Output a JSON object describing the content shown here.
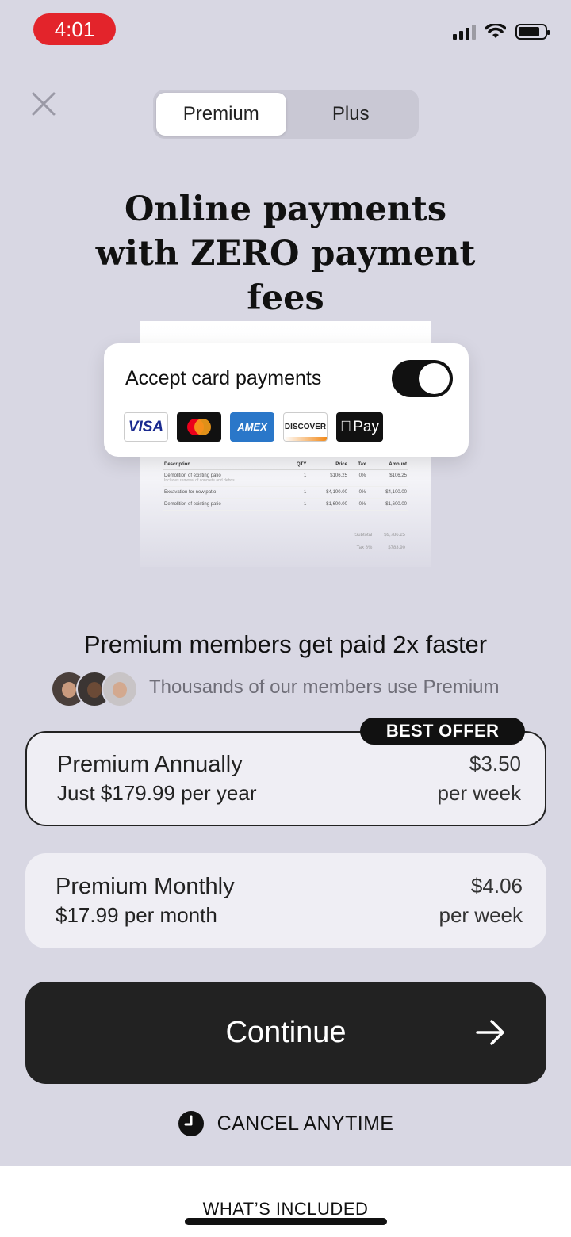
{
  "status_bar": {
    "time": "4:01"
  },
  "tabs": [
    {
      "label": "Premium",
      "active": true
    },
    {
      "label": "Plus",
      "active": false
    }
  ],
  "headline": "Online payments with ZERO payment fees",
  "card_payments": {
    "label": "Accept card payments",
    "toggle_on": true,
    "logos": [
      "VISA",
      "mastercard",
      "AMEX",
      "DISCOVER",
      "Pay"
    ]
  },
  "invoice": {
    "columns": [
      "Description",
      "QTY",
      "Price",
      "Tax",
      "Amount"
    ],
    "rows": [
      {
        "desc": "Demolition of existing patio",
        "sub": "Includes removal of concrete and debris",
        "qty": "1",
        "price": "$106.25",
        "tax": "0%",
        "amount": "$106.25"
      },
      {
        "desc": "Excavation for new patio",
        "sub": "",
        "qty": "1",
        "price": "$4,100.00",
        "tax": "0%",
        "amount": "$4,100.00"
      },
      {
        "desc": "Demolition of existing patio",
        "sub": "",
        "qty": "1",
        "price": "$1,600.00",
        "tax": "0%",
        "amount": "$1,600.00"
      }
    ],
    "subtotal_label": "Subtotal",
    "subtotal": "$9,786.25",
    "tax_label": "Tax 8%",
    "tax": "$783.90"
  },
  "social": {
    "title": "Premium members get paid 2x faster",
    "subtitle": "Thousands of our members use Premium"
  },
  "plans": {
    "badge": "BEST OFFER",
    "annual": {
      "name": "Premium Annually",
      "price": "Just $179.99 per year",
      "weekly": "$3.50",
      "unit": "per week",
      "selected": true
    },
    "monthly": {
      "name": "Premium Monthly",
      "price": "$17.99 per month",
      "weekly": "$4.06",
      "unit": "per week",
      "selected": false
    }
  },
  "cta": {
    "label": "Continue"
  },
  "cancel": {
    "label": "CANCEL ANYTIME"
  },
  "footer": {
    "link": "WHAT’S INCLUDED"
  },
  "colors": {
    "background": "#d8d7e3",
    "accent_dark": "#222222",
    "time_pill": "#e3242b"
  }
}
